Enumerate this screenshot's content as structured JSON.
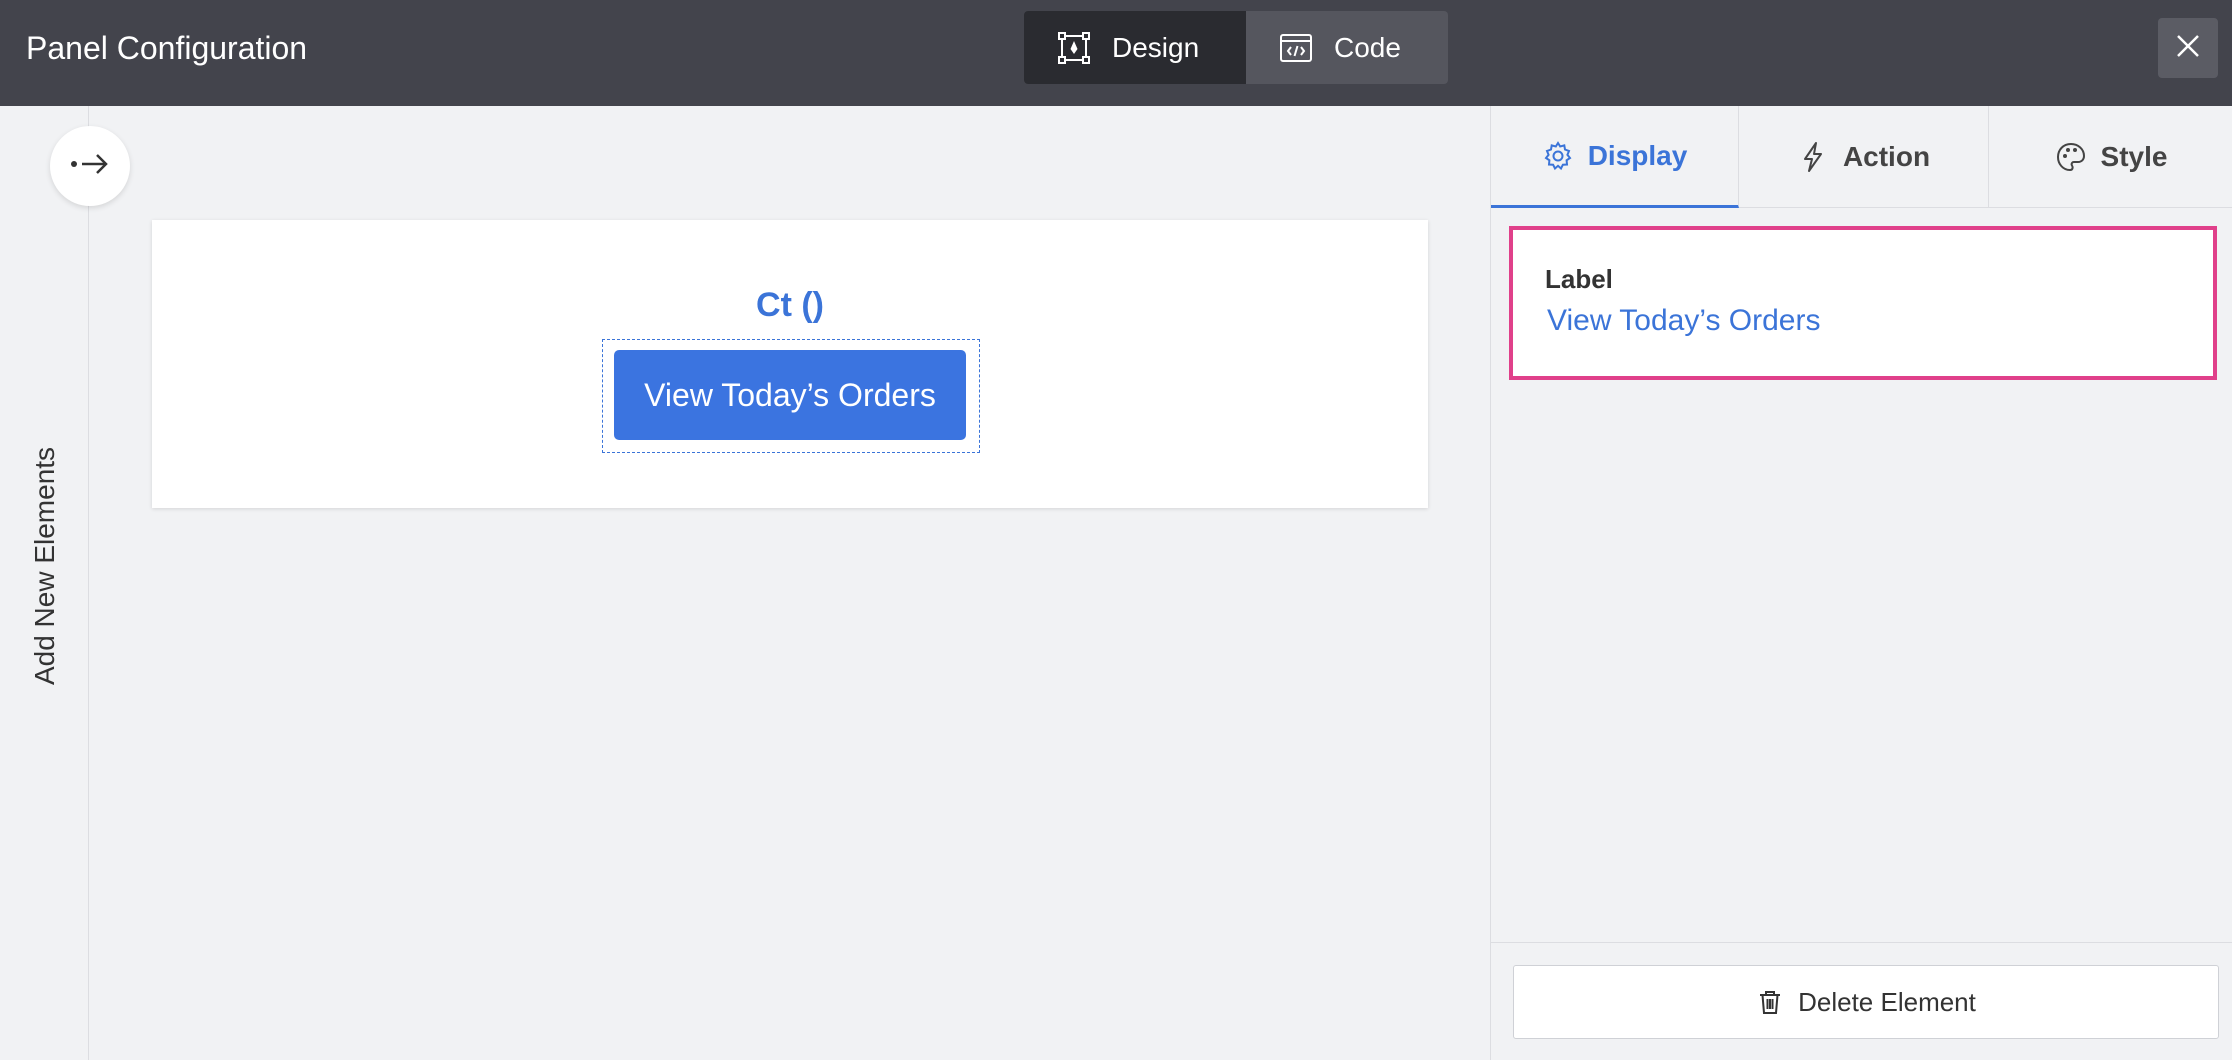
{
  "header": {
    "title": "Panel Configuration",
    "modes": [
      {
        "label": "Design",
        "icon": "design-icon",
        "active": true
      },
      {
        "label": "Code",
        "icon": "code-icon",
        "active": false
      }
    ],
    "close_icon": "close-icon"
  },
  "left_rail": {
    "label": "Add New Elements",
    "expand_icon": "arrow-right-icon"
  },
  "canvas": {
    "heading": "Ct ()",
    "button_label": "View Today’s Orders"
  },
  "right_panel": {
    "tabs": [
      {
        "label": "Display",
        "icon": "gear-icon",
        "active": true
      },
      {
        "label": "Action",
        "icon": "lightning-icon",
        "active": false
      },
      {
        "label": "Style",
        "icon": "palette-icon",
        "active": false
      }
    ],
    "field": {
      "title": "Label",
      "value": "View Today’s Orders"
    },
    "delete_label": "Delete Element"
  },
  "colors": {
    "accent": "#3b74d8",
    "header_bg": "#43444c",
    "highlight_border": "#e0408a"
  }
}
